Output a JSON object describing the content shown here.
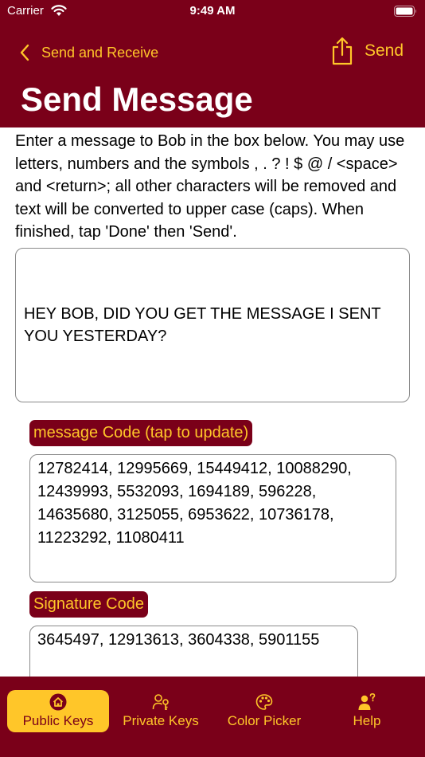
{
  "status_bar": {
    "carrier": "Carrier",
    "time": "9:49 AM"
  },
  "nav": {
    "back_label": "Send and Receive",
    "send_label": "Send",
    "title": "Send Message"
  },
  "instructions": "Enter a message to Bob in the box below. You may use letters, numbers and the symbols , . ? ! $ @ / <space> and <return>; all other characters will be removed and text will be converted to upper case (caps). When finished, tap 'Done' then 'Send'.",
  "message": {
    "text": "HEY BOB, DID YOU GET THE MESSAGE I SENT YOU YESTERDAY?"
  },
  "message_code": {
    "label": "message Code (tap to update)",
    "value": "12782414, 12995669, 15449412, 10088290, 12439993, 5532093, 1694189, 596228, 14635680, 3125055, 6953622, 10736178, 11223292, 11080411"
  },
  "signature_code": {
    "label": "Signature Code",
    "value": "3645497, 12913613, 3604338, 5901155"
  },
  "tabs": [
    {
      "label": "Public Keys",
      "icon": "house-icon",
      "active": true
    },
    {
      "label": "Private Keys",
      "icon": "person-key-icon",
      "active": false
    },
    {
      "label": "Color Picker",
      "icon": "palette-icon",
      "active": false
    },
    {
      "label": "Help",
      "icon": "person-question-icon",
      "active": false
    }
  ],
  "colors": {
    "primary": "#7a0019",
    "accent": "#ffc629",
    "border": "#8a8a8a"
  }
}
